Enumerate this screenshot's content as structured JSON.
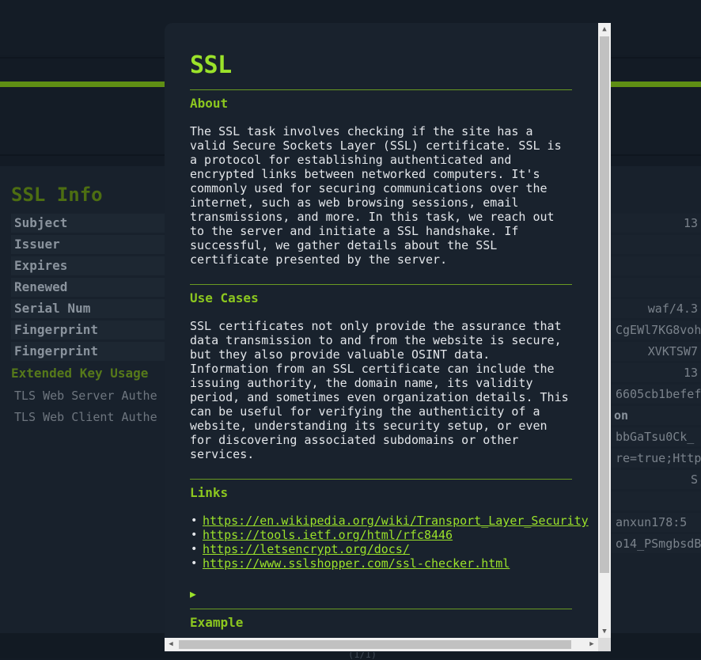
{
  "background": {
    "section_title": "SSL Info",
    "rows": [
      "Subject",
      "Issuer",
      "Expires",
      "Renewed",
      "Serial Num",
      "Fingerprint",
      "Fingerprint"
    ],
    "subhead": "Extended Key Usage",
    "plain_rows": [
      "TLS Web Server Authe",
      "TLS Web Client Authe"
    ],
    "right_cells": [
      "13",
      "",
      "",
      "",
      "waf/4.3",
      "CgEWl7KG8voh",
      "XVKTSW7",
      "13",
      "6605cb1befef",
      "on",
      "bbGaTsu0Ck_",
      "re=true;Http",
      "S",
      "",
      "anxun178:5",
      "o14_PSmgbsdB"
    ],
    "footer": "(1/1)"
  },
  "modal": {
    "title": "SSL",
    "about_heading": "About",
    "about_text": "The SSL task involves checking if the site has a valid Secure Sockets Layer (SSL) certificate. SSL is a protocol for establishing authenticated and encrypted links between networked computers. It's commonly used for securing communications over the internet, such as web browsing sessions, email transmissions, and more. In this task, we reach out to the server and initiate a SSL handshake. If successful, we gather details about the SSL certificate presented by the server.",
    "use_cases_heading": "Use Cases",
    "use_cases_text": "SSL certificates not only provide the assurance that data transmission to and from the website is secure, but they also provide valuable OSINT data. Information from an SSL certificate can include the issuing authority, the domain name, its validity period, and sometimes even organization details. This can be useful for verifying the authenticity of a website, understanding its security setup, or even for discovering associated subdomains or other services.",
    "links_heading": "Links",
    "links": [
      "https://en.wikipedia.org/wiki/Transport_Layer_Security",
      "https://tools.ietf.org/html/rfc8446",
      "https://letsencrypt.org/docs/",
      "https://www.sslshopper.com/ssl-checker.html"
    ],
    "toggle_glyph": "▶",
    "example_heading": "Example"
  },
  "scrollbars": {
    "up": "▲",
    "down": "▼",
    "left": "◀",
    "right": "▶"
  },
  "colors": {
    "accent": "#9be22a",
    "background": "#131b25",
    "modal": "#19222d"
  }
}
